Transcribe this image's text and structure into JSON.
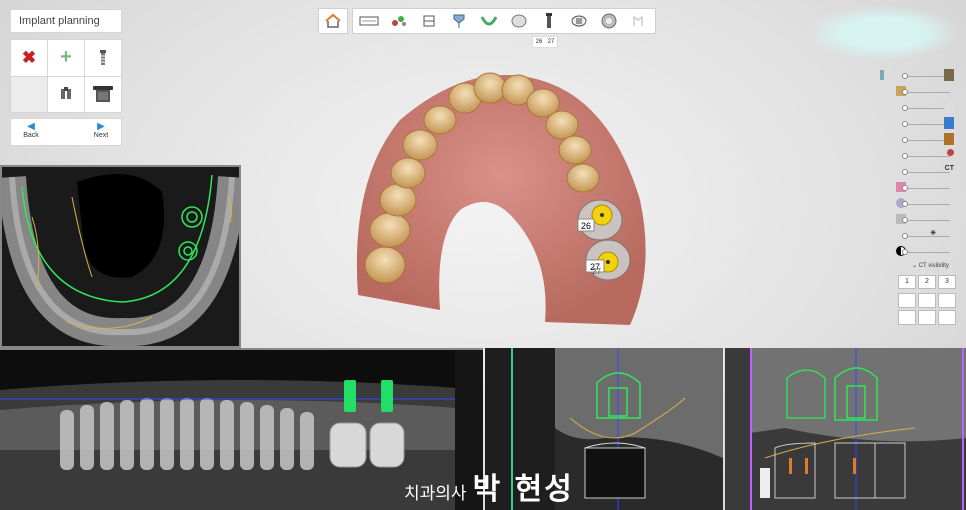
{
  "panel": {
    "title": "Implant planning",
    "back_label": "Back",
    "next_label": "Next"
  },
  "toolbar": {
    "tooth_badges": [
      "26",
      "27"
    ]
  },
  "model": {
    "implant_labels": [
      "26",
      "27",
      "27"
    ]
  },
  "side_panel": {
    "ct_end_label": "CT",
    "ct_visibility_label": "CT visibility",
    "ct_view_buttons": [
      "1",
      "2",
      "3"
    ]
  },
  "watermark": {
    "prefix": "치과의사",
    "name": "박 현성"
  },
  "colors": {
    "implant_green": "#22dd66",
    "axis_blue": "#3344ff",
    "axis_green": "#55ffaa",
    "nerve_yellow": "#d8b04a",
    "accent_orange": "#e07b2a"
  }
}
